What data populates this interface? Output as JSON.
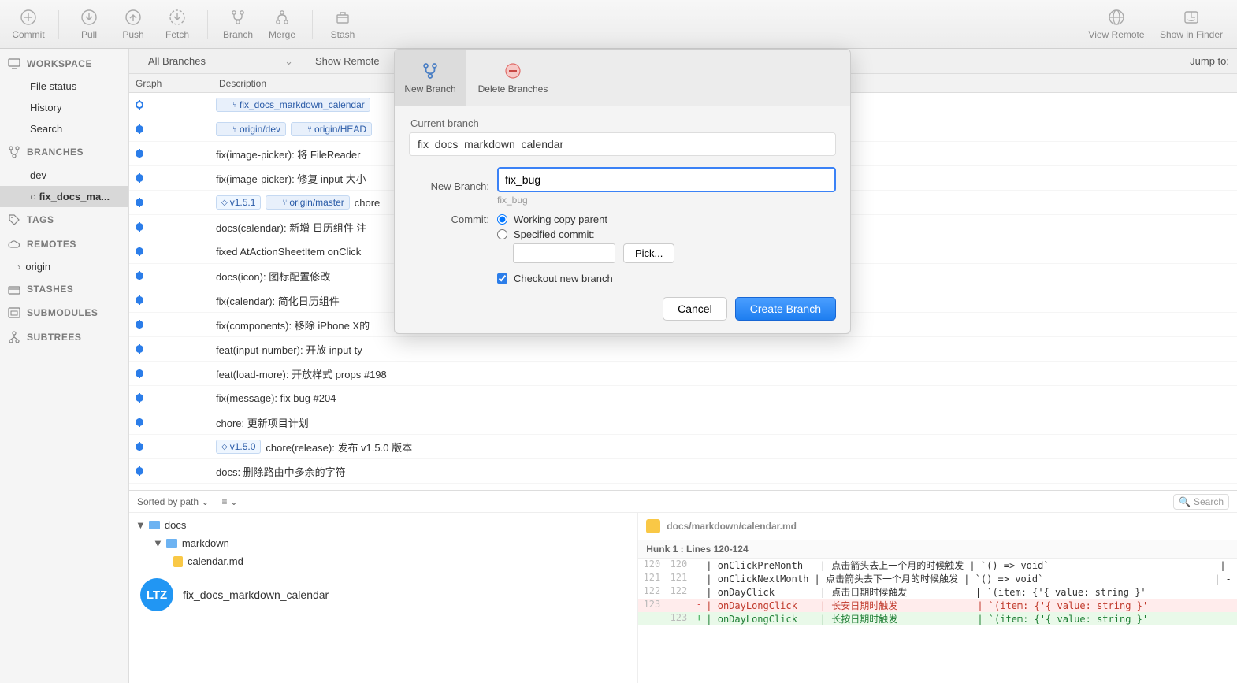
{
  "toolbar": {
    "commit": "Commit",
    "pull": "Pull",
    "push": "Push",
    "fetch": "Fetch",
    "branch": "Branch",
    "merge": "Merge",
    "stash": "Stash",
    "view_remote": "View Remote",
    "show_in_finder": "Show in Finder"
  },
  "subtoolbar": {
    "all_branches": "All Branches",
    "show_remote": "Show Remote",
    "jump_to": "Jump to:"
  },
  "sidebar": {
    "workspace": "WORKSPACE",
    "file_status": "File status",
    "history": "History",
    "search": "Search",
    "branches": "BRANCHES",
    "dev": "dev",
    "fix_docs": "fix_docs_ma...",
    "tags": "TAGS",
    "remotes": "REMOTES",
    "origin": "origin",
    "stashes": "STASHES",
    "submodules": "SUBMODULES",
    "subtrees": "SUBTREES"
  },
  "list": {
    "graph_header": "Graph",
    "desc_header": "Description"
  },
  "commits": [
    {
      "tags": [
        {
          "t": "branch",
          "v": "fix_docs_markdown_calendar"
        }
      ],
      "msg": "",
      "hollow": true
    },
    {
      "tags": [
        {
          "t": "branch",
          "v": "origin/dev"
        },
        {
          "t": "branch",
          "v": "origin/HEAD"
        }
      ],
      "msg": ""
    },
    {
      "tags": [],
      "msg": "fix(image-picker): 将 FileReader "
    },
    {
      "tags": [],
      "msg": "fix(image-picker): 修复 input 大小"
    },
    {
      "tags": [
        {
          "t": "ver",
          "v": "v1.5.1"
        },
        {
          "t": "branch",
          "v": "origin/master"
        }
      ],
      "msg": "chore"
    },
    {
      "tags": [],
      "msg": "docs(calendar): 新增 日历组件 注"
    },
    {
      "tags": [],
      "msg": "fixed AtActionSheetItem onClick"
    },
    {
      "tags": [],
      "msg": "docs(icon): 图标配置修改"
    },
    {
      "tags": [],
      "msg": "fix(calendar): 简化日历组件"
    },
    {
      "tags": [],
      "msg": "fix(components): 移除 iPhone X的"
    },
    {
      "tags": [],
      "msg": "feat(input-number): 开放 input ty"
    },
    {
      "tags": [],
      "msg": "feat(load-more): 开放样式 props #198"
    },
    {
      "tags": [],
      "msg": "fix(message): fix bug #204"
    },
    {
      "tags": [],
      "msg": "chore: 更新项目计划"
    },
    {
      "tags": [
        {
          "t": "ver",
          "v": "v1.5.0"
        }
      ],
      "msg": "chore(release): 发布 v1.5.0 版本"
    },
    {
      "tags": [],
      "msg": "docs: 删除路由中多余的字符"
    }
  ],
  "bottom": {
    "sorted_by_path": "Sorted by path",
    "search_placeholder": "Search",
    "folder_docs": "docs",
    "folder_markdown": "markdown",
    "file_calendar": "calendar.md",
    "avatar": "LTZ",
    "commit_title": "fix_docs_markdown_calendar",
    "diff_file": "docs/markdown/calendar.md",
    "hunk_header": "Hunk 1 : Lines 120-124",
    "lines": [
      {
        "l": "120",
        "r": "120",
        "m": "",
        "code": "| onClickPreMonth   | 点击箭头去上一个月的时候触发 | `() => void`                              | -"
      },
      {
        "l": "121",
        "r": "121",
        "m": "",
        "code": "| onClickNextMonth | 点击箭头去下一个月的时候触发 | `() => void`                              | -"
      },
      {
        "l": "122",
        "r": "122",
        "m": "",
        "code": "| onDayClick        | 点击日期时候触发            | `(item: {'{ value: string }'"
      },
      {
        "l": "123",
        "r": "",
        "m": "-",
        "cls": "del",
        "code": "| onDayLongClick    | 长安日期时触发              | `(item: {'{ value: string }'"
      },
      {
        "l": "",
        "r": "123",
        "m": "+",
        "cls": "add",
        "code": "| onDayLongClick    | 长按日期时触发              | `(item: {'{ value: string }'"
      }
    ]
  },
  "modal": {
    "tab_new_branch": "New Branch",
    "tab_delete_branches": "Delete Branches",
    "current_branch_label": "Current branch",
    "current_branch": "fix_docs_markdown_calendar",
    "new_branch_label": "New Branch:",
    "new_branch_value": "fix_bug",
    "new_branch_hint": "fix_bug",
    "commit_label": "Commit:",
    "radio_working": "Working copy parent",
    "radio_specified": "Specified commit:",
    "pick": "Pick...",
    "checkout": "Checkout new branch",
    "cancel": "Cancel",
    "create": "Create Branch"
  }
}
